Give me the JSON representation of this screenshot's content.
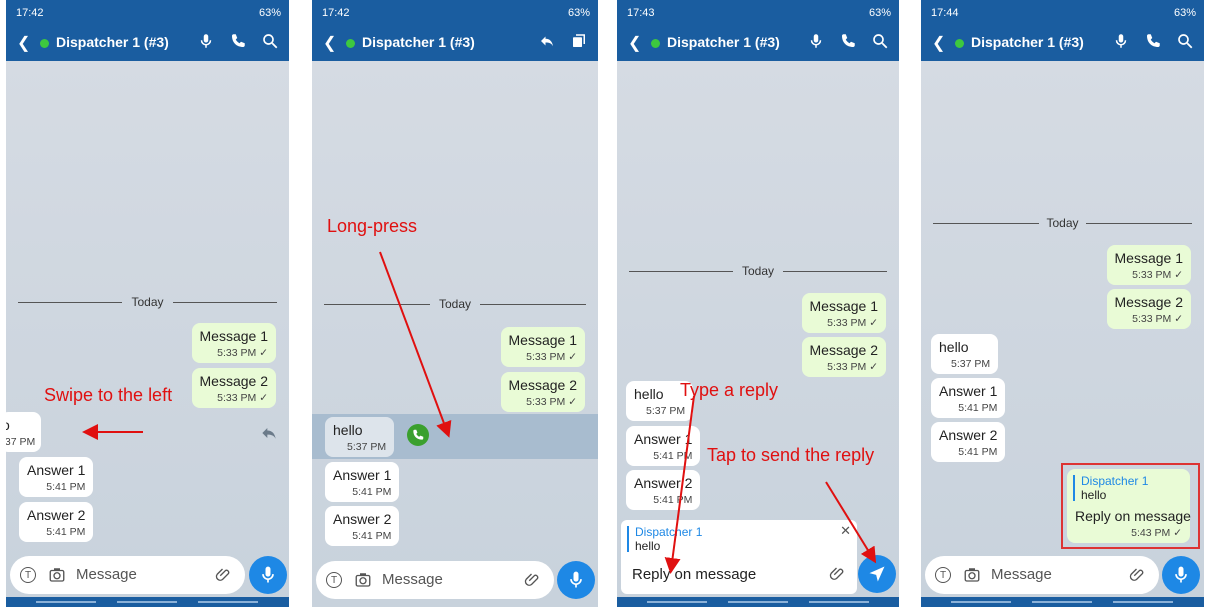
{
  "status": {
    "p1_time": "17:42",
    "p2_time": "17:42",
    "p3_time": "17:43",
    "p4_time": "17:44",
    "battery": "63%"
  },
  "header": {
    "title": "Dispatcher 1 (#3)"
  },
  "date_separator": "Today",
  "messages": {
    "msg1": "Message 1",
    "msg1_time": "5:33 PM ✓",
    "msg2": "Message 2",
    "msg2_time": "5:33 PM ✓",
    "hello": "hello",
    "hello_time": "5:37 PM",
    "hello_partial": "o",
    "hello_time_partial": ":37 PM",
    "ans1": "Answer 1",
    "ans1_time": "5:41 PM",
    "ans2": "Answer 2",
    "ans2_time": "5:41 PM",
    "reply": "Reply on message",
    "reply_time": "5:43 PM ✓"
  },
  "quote": {
    "author": "Dispatcher 1",
    "text": "hello"
  },
  "composer": {
    "placeholder": "Message",
    "typed": "Reply on message"
  },
  "annotations": {
    "swipe": "Swipe to the left",
    "longpress": "Long-press",
    "type_reply": "Type a reply",
    "tap_send": "Tap to send the reply"
  },
  "colors": {
    "header": "#1a5da0",
    "online": "#3dc83f",
    "outgoing": "#e9fbd6",
    "accent": "#1e88e5",
    "annotation": "#e01010"
  }
}
